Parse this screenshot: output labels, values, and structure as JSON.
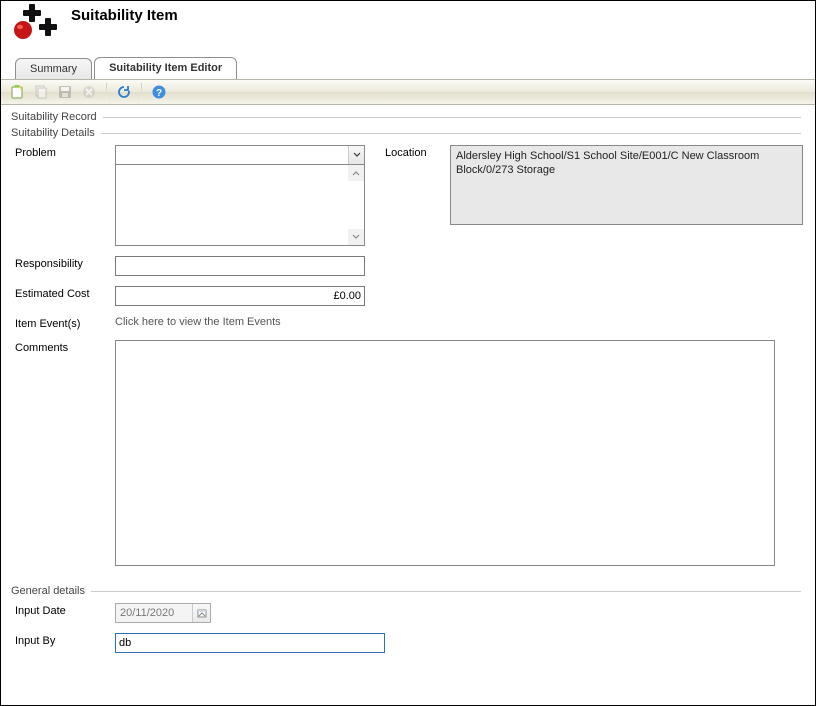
{
  "header": {
    "title": "Suitability Item"
  },
  "tabs": [
    {
      "label": "Summary"
    },
    {
      "label": "Suitability Item Editor"
    }
  ],
  "fieldsets": {
    "record": "Suitability Record",
    "details": "Suitability Details",
    "general": "General details"
  },
  "labels": {
    "problem": "Problem",
    "location": "Location",
    "responsibility": "Responsibility",
    "estimated_cost": "Estimated Cost",
    "item_events": "Item Event(s)",
    "comments": "Comments",
    "input_date": "Input Date",
    "input_by": "Input By"
  },
  "values": {
    "problem": "",
    "location": "Aldersley High School/S1 School Site/E001/C New Classroom Block/0/273 Storage",
    "responsibility": "",
    "estimated_cost": "£0.00",
    "item_events_link": "Click here to view the Item Events",
    "comments": "",
    "input_date": "20/11/2020",
    "input_by": "db"
  }
}
